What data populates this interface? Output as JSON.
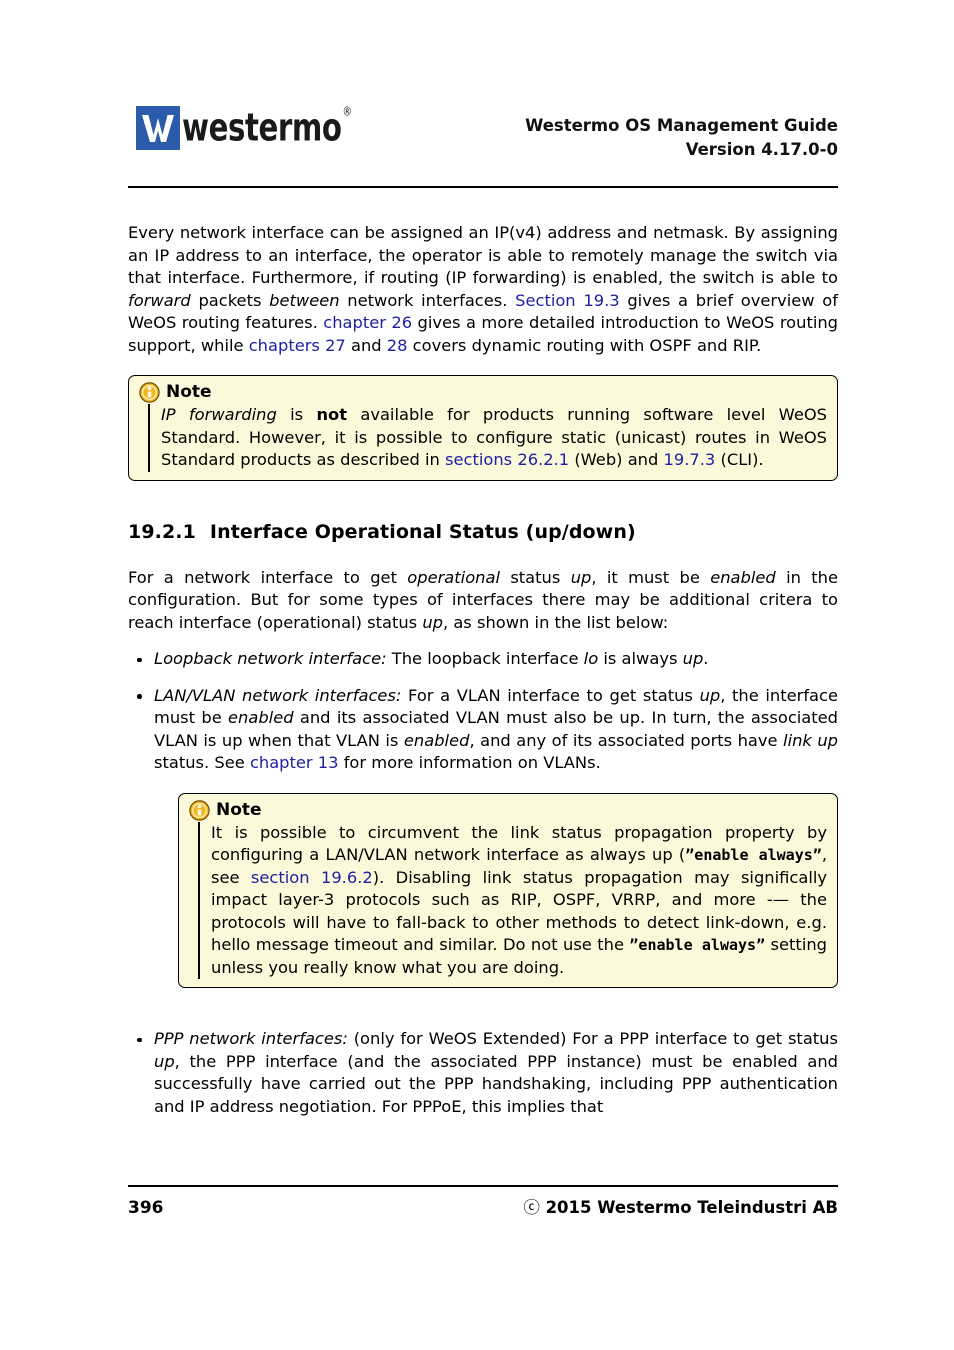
{
  "header": {
    "logo_word": "westermo",
    "logo_trademark": "®",
    "title_line1": "Westermo OS Management Guide",
    "title_line2": "Version 4.17.0-0"
  },
  "footer": {
    "page_number": "396",
    "copyright_symbol": "ⓒ",
    "copyright_text": "2015 Westermo Teleindustri AB"
  },
  "colors": {
    "link": "#2020a0",
    "logo_blue": "#2a5caa",
    "note_background": "#fcf9da",
    "note_border": "#000000",
    "note_icon_fill": "#f2b824",
    "text": "#000000"
  },
  "content": {
    "intro_paragraph": {
      "t1": "Every network interface can be assigned an IP(v4) address and netmask. By assigning an IP address to an interface, the operator is able to remotely manage the switch via that interface. Furthermore, if routing (IP forwarding) is enabled, the switch is able to ",
      "i1": "forward",
      "t2": " packets ",
      "i2": "between",
      "t3": " network interfaces. ",
      "link1": "Section 19.3",
      "t4": " gives a brief overview of WeOS routing features. ",
      "link2": "chapter 26",
      "t5": " gives a more detailed introduction to WeOS routing support, while ",
      "link3": "chapters 27",
      "t6": " and ",
      "link4": "28",
      "t7": " covers dynamic routing with OSPF and RIP."
    },
    "note1": {
      "title": "Note",
      "icon": "info-icon",
      "i1": "IP forwarding",
      "t1": " is ",
      "b1": "not",
      "t2": " available for products running software level WeOS Standard. However, it is possible to configure static (unicast) routes in WeOS Standard products as described in ",
      "link1": "sections 26.2.1",
      "t3": " (Web) and ",
      "link2": "19.7.3",
      "t4": " (CLI)."
    },
    "section_heading": {
      "number": "19.2.1",
      "title": "Interface Operational Status (up/down)"
    },
    "paragraph2": {
      "t1": "For a network interface to get ",
      "i1": "operational",
      "t2": " status ",
      "i2": "up",
      "t3": ", it must be ",
      "i3": "enabled",
      "t4": " in the configuration. But for some types of interfaces there may be additional critera to reach interface (operational) status ",
      "i4": "up",
      "t5": ", as shown in the list below:"
    },
    "bullets": [
      {
        "lead": "Loopback network interface:",
        "t1": " The loopback interface ",
        "i1": "lo",
        "t2": " is always ",
        "i2": "up",
        "t3": "."
      },
      {
        "lead": "LAN/VLAN network interfaces:",
        "t1": " For a VLAN interface to get status ",
        "i1": "up",
        "t2": ", the interface must be ",
        "i2": "enabled",
        "t3": " and its associated VLAN must also be up. In turn, the associated VLAN is up when that VLAN is ",
        "i3": "enabled",
        "t4": ", and any of its associated ports have ",
        "i4": "link up",
        "t5": " status. See ",
        "link1": "chapter 13",
        "t6": " for more information on VLANs."
      },
      {
        "lead": "PPP network interfaces:",
        "t1": " (only for WeOS Extended) For a PPP interface to get status ",
        "i1": "up",
        "t2": ", the PPP interface (and the associated PPP instance) must be enabled and successfully have carried out the PPP handshaking, including PPP authentication and IP address negotiation. For PPPoE, this implies that"
      }
    ],
    "note2": {
      "title": "Note",
      "icon": "info-icon",
      "t1": "It is possible to circumvent the link status propagation property by configuring a LAN/VLAN network interface as always up (",
      "m1": "”enable always”",
      "t2": ", see ",
      "link1": "section 19.6.2",
      "t3": "). Disabling link status propagation may significally impact layer-3 protocols such as RIP, OSPF, VRRP, and more -— the protocols will have to fall-back to other methods to detect link-down, e.g. hello message timeout and similar. Do not use the ",
      "m2": "”enable always”",
      "t4": " setting unless you really know what you are doing."
    }
  }
}
